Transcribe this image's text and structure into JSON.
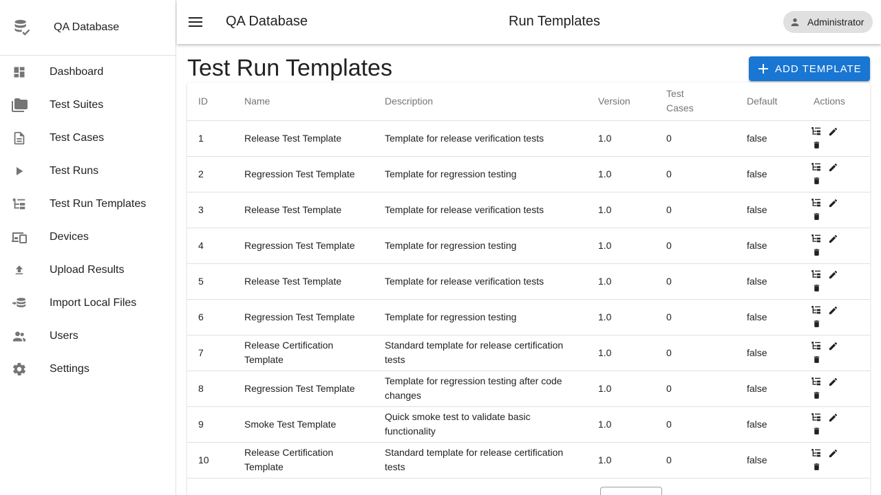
{
  "brand": {
    "title": "QA Database",
    "icon": "database-check-icon"
  },
  "nav": [
    {
      "label": "Dashboard",
      "icon": "dashboard-icon"
    },
    {
      "label": "Test Suites",
      "icon": "folder-icon"
    },
    {
      "label": "Test Cases",
      "icon": "document-icon"
    },
    {
      "label": "Test Runs",
      "icon": "play-icon"
    },
    {
      "label": "Test Run Templates",
      "icon": "tree-icon"
    },
    {
      "label": "Devices",
      "icon": "devices-icon"
    },
    {
      "label": "Upload Results",
      "icon": "upload-icon"
    },
    {
      "label": "Import Local Files",
      "icon": "import-icon"
    },
    {
      "label": "Users",
      "icon": "users-icon"
    },
    {
      "label": "Settings",
      "icon": "gear-icon"
    }
  ],
  "topbar": {
    "app_title": "QA Database",
    "page_title": "Run Templates",
    "user": "Administrator"
  },
  "page": {
    "heading": "Test Run Templates",
    "add_button": "ADD TEMPLATE"
  },
  "colors": {
    "primary": "#1976d2",
    "chip": "#e0e0e0"
  },
  "table": {
    "columns": [
      "ID",
      "Name",
      "Description",
      "Version",
      "Test Cases",
      "Default",
      "Actions"
    ],
    "rows": [
      {
        "id": "1",
        "name": "Release Test Template",
        "description": "Template for release verification tests",
        "version": "1.0",
        "test_cases": "0",
        "default": "false"
      },
      {
        "id": "2",
        "name": "Regression Test Template",
        "description": "Template for regression testing",
        "version": "1.0",
        "test_cases": "0",
        "default": "false"
      },
      {
        "id": "3",
        "name": "Release Test Template",
        "description": "Template for release verification tests",
        "version": "1.0",
        "test_cases": "0",
        "default": "false"
      },
      {
        "id": "4",
        "name": "Regression Test Template",
        "description": "Template for regression testing",
        "version": "1.0",
        "test_cases": "0",
        "default": "false"
      },
      {
        "id": "5",
        "name": "Release Test Template",
        "description": "Template for release verification tests",
        "version": "1.0",
        "test_cases": "0",
        "default": "false"
      },
      {
        "id": "6",
        "name": "Regression Test Template",
        "description": "Template for regression testing",
        "version": "1.0",
        "test_cases": "0",
        "default": "false"
      },
      {
        "id": "7",
        "name": "Release Certification Template",
        "description": "Standard template for release certification tests",
        "version": "1.0",
        "test_cases": "0",
        "default": "false"
      },
      {
        "id": "8",
        "name": "Regression Test Template",
        "description": "Template for regression testing after code changes",
        "version": "1.0",
        "test_cases": "0",
        "default": "false"
      },
      {
        "id": "9",
        "name": "Smoke Test Template",
        "description": "Quick smoke test to validate basic functionality",
        "version": "1.0",
        "test_cases": "0",
        "default": "false"
      },
      {
        "id": "10",
        "name": "Release Certification Template",
        "description": "Standard template for release certification tests",
        "version": "1.0",
        "test_cases": "0",
        "default": "false"
      }
    ]
  }
}
